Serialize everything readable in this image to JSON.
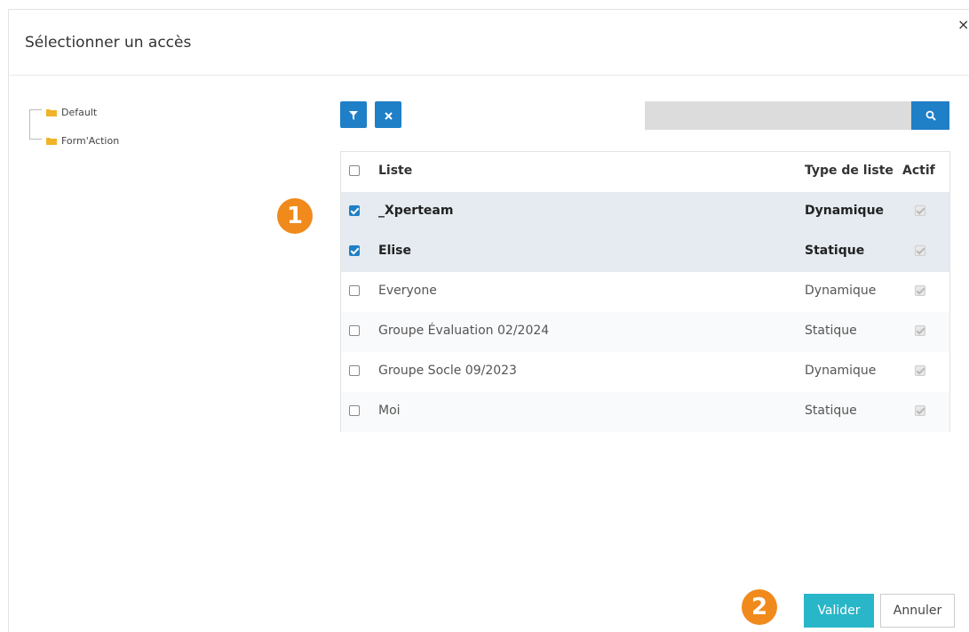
{
  "modal": {
    "title": "Sélectionner un accès",
    "close_label": "×"
  },
  "tree": {
    "items": [
      {
        "label": "Default",
        "icon": "folder-icon"
      },
      {
        "label": "Form'Action",
        "icon": "folder-icon"
      }
    ]
  },
  "toolbar": {
    "filter_icon": "filter-icon",
    "clear_icon": "close-icon",
    "search_value": "",
    "search_icon": "search-icon"
  },
  "table": {
    "headers": {
      "name": "Liste",
      "type": "Type de liste",
      "active": "Actif"
    },
    "rows": [
      {
        "name": "_Xperteam",
        "type": "Dynamique",
        "selected": true,
        "active": true
      },
      {
        "name": "Elise",
        "type": "Statique",
        "selected": true,
        "active": true
      },
      {
        "name": "Everyone",
        "type": "Dynamique",
        "selected": false,
        "active": true
      },
      {
        "name": "Groupe Évaluation 02/2024",
        "type": "Statique",
        "selected": false,
        "active": true
      },
      {
        "name": "Groupe Socle 09/2023",
        "type": "Dynamique",
        "selected": false,
        "active": true
      },
      {
        "name": "Moi",
        "type": "Statique",
        "selected": false,
        "active": true
      }
    ]
  },
  "badges": {
    "one": "1",
    "two": "2"
  },
  "footer": {
    "validate_label": "Valider",
    "cancel_label": "Annuler"
  },
  "colors": {
    "primary": "#1f7fc7",
    "validate": "#29b6c9",
    "badge": "#f08a1c",
    "selected_row": "#e5ebf0",
    "folder": "#f0b429"
  }
}
